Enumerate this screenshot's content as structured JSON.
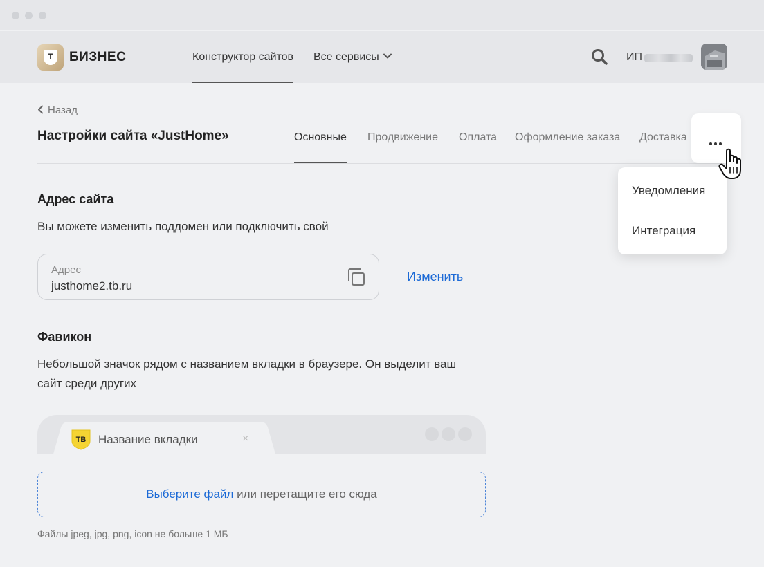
{
  "header": {
    "brand": "БИЗНЕС",
    "logo_letter": "Т",
    "nav": [
      {
        "label": "Конструктор сайтов"
      },
      {
        "label": "Все сервисы"
      }
    ],
    "user_prefix": "ИП"
  },
  "page": {
    "back_label": "Назад",
    "title": "Настройки сайта «JustHome»",
    "tabs": [
      {
        "label": "Основные",
        "active": true
      },
      {
        "label": "Продвижение"
      },
      {
        "label": "Оплата"
      },
      {
        "label": "Оформление заказа"
      },
      {
        "label": "Доставка"
      }
    ]
  },
  "more_menu": {
    "items": [
      {
        "label": "Уведомления"
      },
      {
        "label": "Интеграция"
      }
    ]
  },
  "address_section": {
    "heading": "Адрес сайта",
    "description": "Вы можете изменить поддомен или подключить свой",
    "field_label": "Адрес",
    "field_value": "justhome2.tb.ru",
    "change_link": "Изменить"
  },
  "favicon_section": {
    "heading": "Фавикон",
    "description": "Небольшой значок рядом с названием вкладки в браузере. Он выделит ваш сайт среди других",
    "badge_text": "ТВ",
    "tab_label": "Название вкладки",
    "tab_close": "×",
    "dropzone_link": "Выберите файл",
    "dropzone_text": " или перетащите его сюда",
    "hint": "Файлы jpeg, jpg, png, icon не больше 1 МБ"
  },
  "colors": {
    "accent_link": "#1c6ad6",
    "badge_yellow": "#f5d433",
    "background": "#f0f1f3"
  }
}
